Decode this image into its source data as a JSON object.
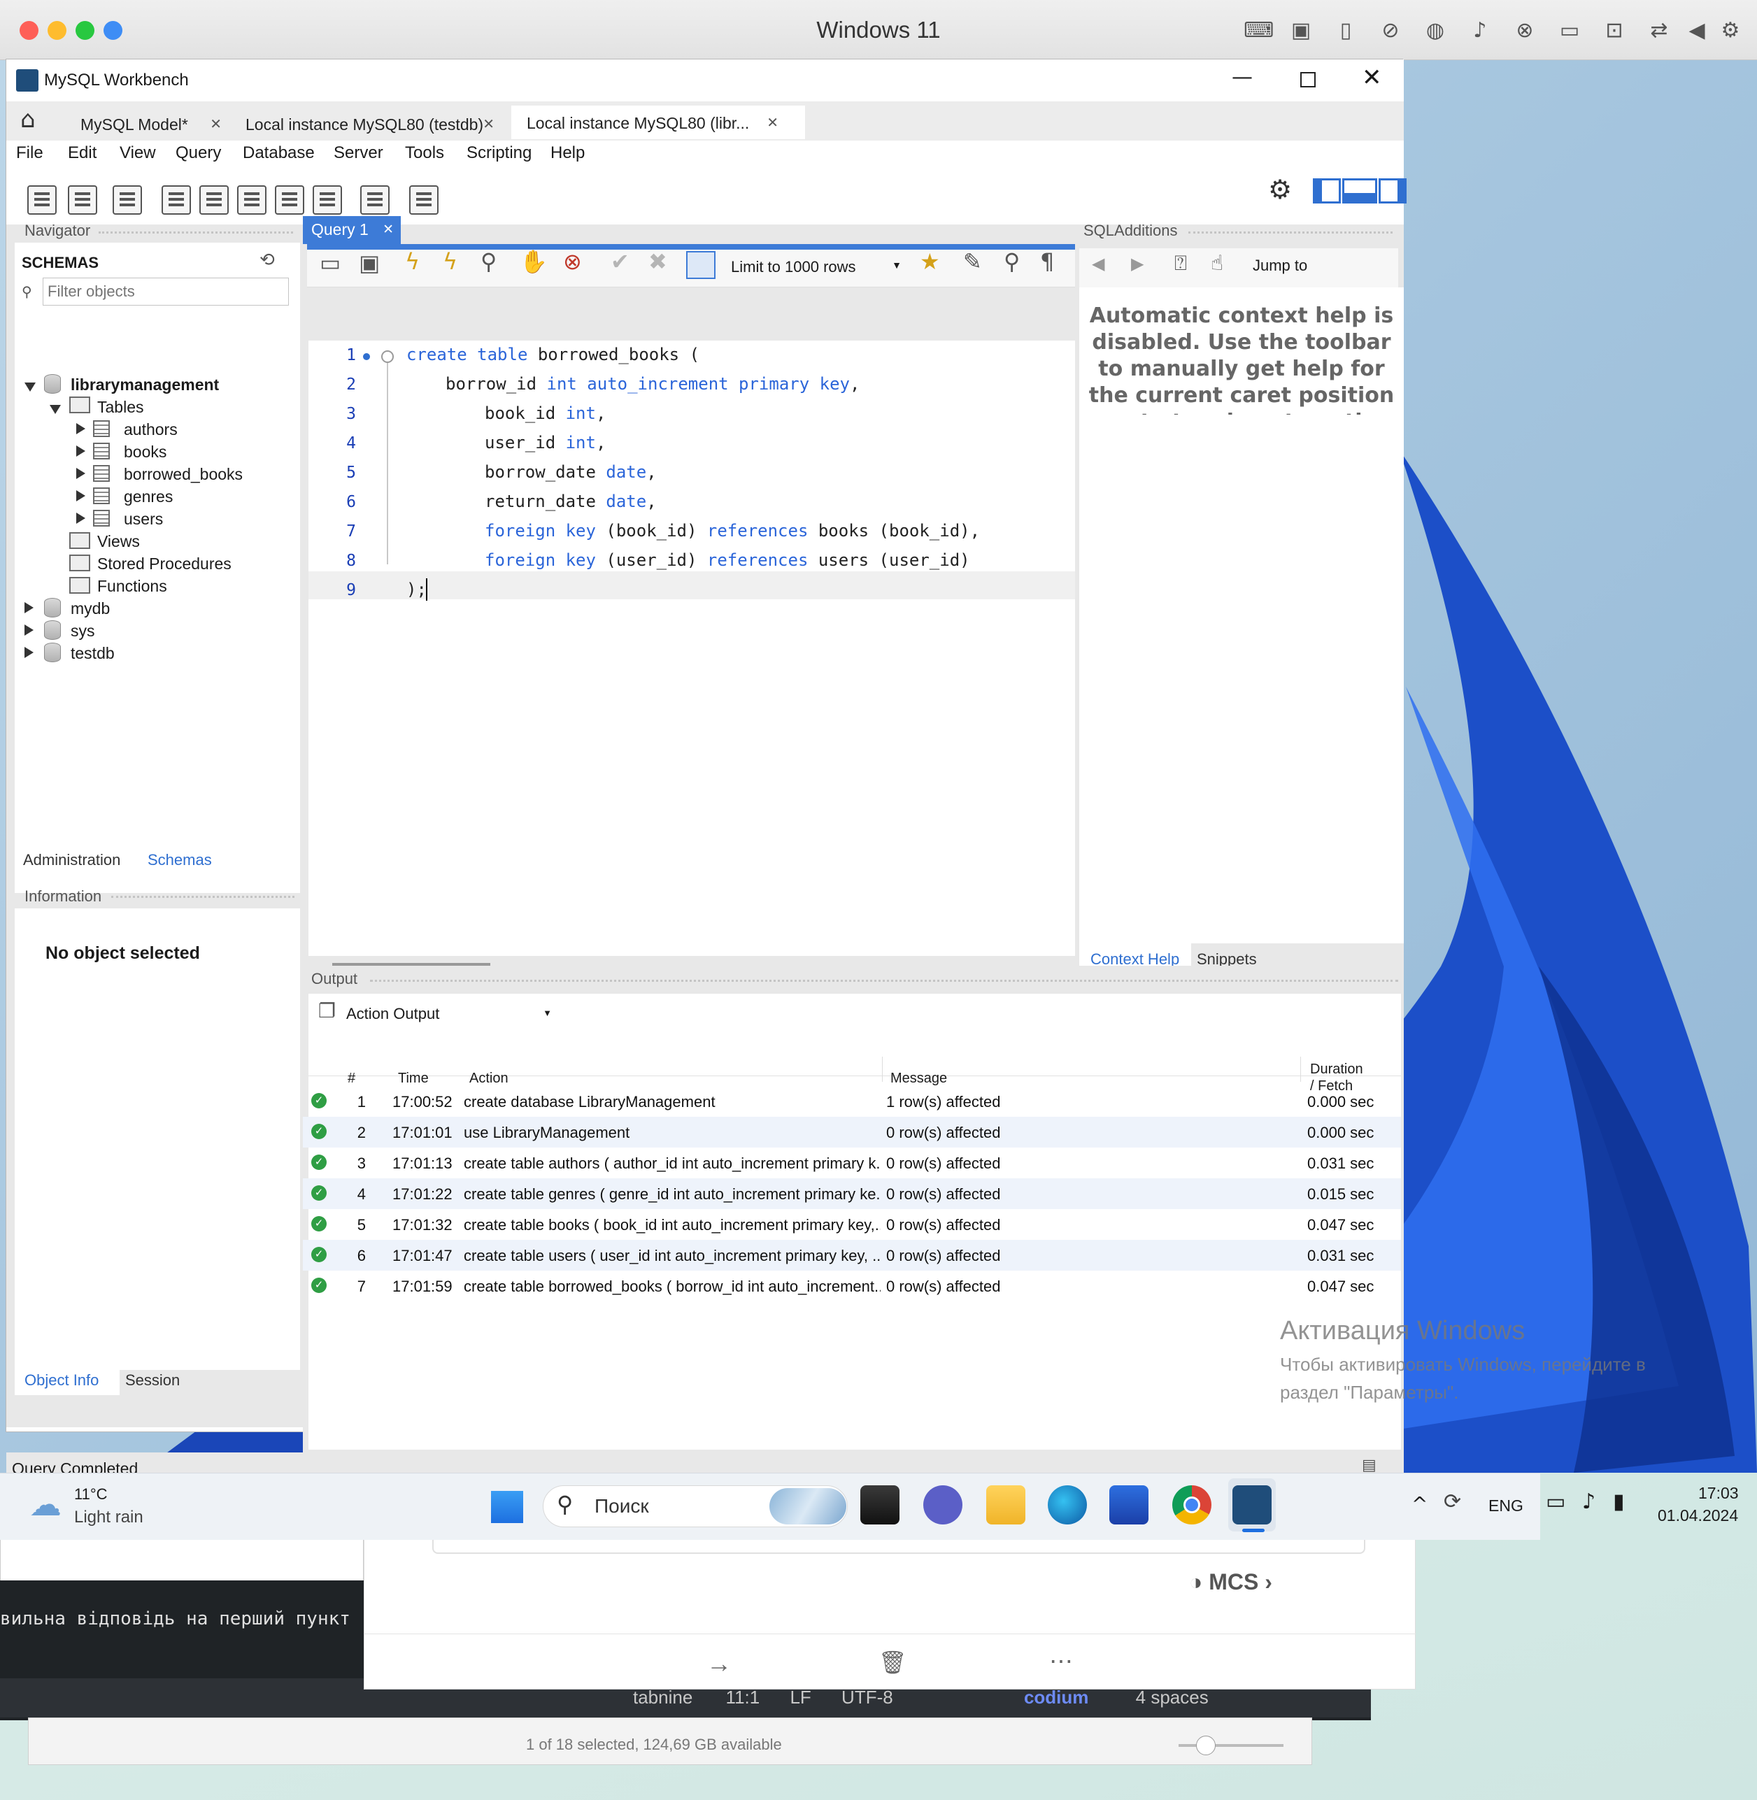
{
  "mac": {
    "title": "Windows 11"
  },
  "window": {
    "title": "MySQL Workbench"
  },
  "tabs": [
    {
      "label": "MySQL Model*"
    },
    {
      "label": "Local instance MySQL80 (testdb)"
    },
    {
      "label": "Local instance MySQL80 (libr..."
    }
  ],
  "menu": [
    "File",
    "Edit",
    "View",
    "Query",
    "Database",
    "Server",
    "Tools",
    "Scripting",
    "Help"
  ],
  "navigator": {
    "header": "Navigator",
    "schemas_title": "SCHEMAS",
    "filter_placeholder": "Filter objects",
    "tree": {
      "db": "librarymanagement",
      "tables_label": "Tables",
      "tables": [
        "authors",
        "books",
        "borrowed_books",
        "genres",
        "users"
      ],
      "views": "Views",
      "procedures": "Stored Procedures",
      "functions": "Functions",
      "other_dbs": [
        "mydb",
        "sys",
        "testdb"
      ]
    },
    "bottom_tabs": [
      "Administration",
      "Schemas"
    ],
    "info_header": "Information",
    "no_object": "No object selected",
    "info_tabs": [
      "Object Info",
      "Session"
    ]
  },
  "query": {
    "tab_label": "Query 1",
    "limit_label": "Limit to 1000 rows",
    "line_numbers": [
      "1",
      "2",
      "3",
      "4",
      "5",
      "6",
      "7",
      "8",
      "9"
    ],
    "code": [
      [
        {
          "t": "create table",
          "k": true
        },
        {
          "t": " borrowed_books (",
          "k": false
        }
      ],
      [
        {
          "t": "borrow_id ",
          "k": false
        },
        {
          "t": "int auto_increment primary key",
          "k": true
        },
        {
          "t": ",",
          "k": false
        }
      ],
      [
        {
          "t": "book_id ",
          "k": false
        },
        {
          "t": "int",
          "k": true
        },
        {
          "t": ",",
          "k": false
        }
      ],
      [
        {
          "t": "user_id ",
          "k": false
        },
        {
          "t": "int",
          "k": true
        },
        {
          "t": ",",
          "k": false
        }
      ],
      [
        {
          "t": "borrow_date ",
          "k": false
        },
        {
          "t": "date",
          "k": true
        },
        {
          "t": ",",
          "k": false
        }
      ],
      [
        {
          "t": "return_date ",
          "k": false
        },
        {
          "t": "date",
          "k": true
        },
        {
          "t": ",",
          "k": false
        }
      ],
      [
        {
          "t": "foreign key",
          "k": true
        },
        {
          "t": " (book_id) ",
          "k": false
        },
        {
          "t": "references",
          "k": true
        },
        {
          "t": " books (book_id),",
          "k": false
        }
      ],
      [
        {
          "t": "foreign key",
          "k": true
        },
        {
          "t": " (user_id) ",
          "k": false
        },
        {
          "t": "references",
          "k": true
        },
        {
          "t": " users (user_id)",
          "k": false
        }
      ],
      [
        {
          "t": ");",
          "k": false
        }
      ]
    ]
  },
  "sql_additions": {
    "header": "SQLAdditions",
    "jump_to": "Jump to",
    "help_text": "Automatic context help is disabled. Use the toolbar to manually get help for the current caret position or to toggle automatic help.",
    "tabs": [
      "Context Help",
      "Snippets"
    ]
  },
  "output": {
    "header": "Output",
    "dropdown": "Action Output",
    "columns": {
      "num": "#",
      "time": "Time",
      "action": "Action",
      "message": "Message",
      "duration": "Duration / Fetch"
    },
    "rows": [
      {
        "num": "1",
        "time": "17:00:52",
        "action": "create database LibraryManagement",
        "message": "1 row(s) affected",
        "duration": "0.000 sec"
      },
      {
        "num": "2",
        "time": "17:01:01",
        "action": "use LibraryManagement",
        "message": "0 row(s) affected",
        "duration": "0.000 sec"
      },
      {
        "num": "3",
        "time": "17:01:13",
        "action": "create table authors ( author_id int auto_increment primary k...",
        "message": "0 row(s) affected",
        "duration": "0.031 sec"
      },
      {
        "num": "4",
        "time": "17:01:22",
        "action": "create table genres ( genre_id int auto_increment primary ke...",
        "message": "0 row(s) affected",
        "duration": "0.015 sec"
      },
      {
        "num": "5",
        "time": "17:01:32",
        "action": "create table books ( book_id int auto_increment primary key,...",
        "message": "0 row(s) affected",
        "duration": "0.047 sec"
      },
      {
        "num": "6",
        "time": "17:01:47",
        "action": "create table users ( user_id int auto_increment primary key, ...",
        "message": "0 row(s) affected",
        "duration": "0.031 sec"
      },
      {
        "num": "7",
        "time": "17:01:59",
        "action": "create table borrowed_books ( borrow_id int auto_increment...",
        "message": "0 row(s) affected",
        "duration": "0.047 sec"
      }
    ]
  },
  "status": {
    "text": "Query Completed"
  },
  "activation": {
    "title": "Активация Windows",
    "line1": "Чтобы активировать Windows, перейдите в",
    "line2": "раздел \"Параметры\"."
  },
  "taskbar": {
    "temp": "11°C",
    "weather": "Light rain",
    "search": "Поиск",
    "lang": "ENG",
    "time": "17:03",
    "date": "01.04.2024"
  },
  "background": {
    "mcs": "MCS",
    "ukr_text": "вильна відповідь на перший пункт -",
    "vscode_status": {
      "tabnine": "tabnine",
      "pos": "11:1",
      "eol": "LF",
      "enc": "UTF-8",
      "codium": "codium",
      "spaces": "4 spaces"
    },
    "finder_status": "1 of 18 selected, 124,69 GB available"
  },
  "colors": {
    "accent": "#3d7bd7",
    "keyword": "#2b65d9",
    "ok": "#2f9e44"
  }
}
